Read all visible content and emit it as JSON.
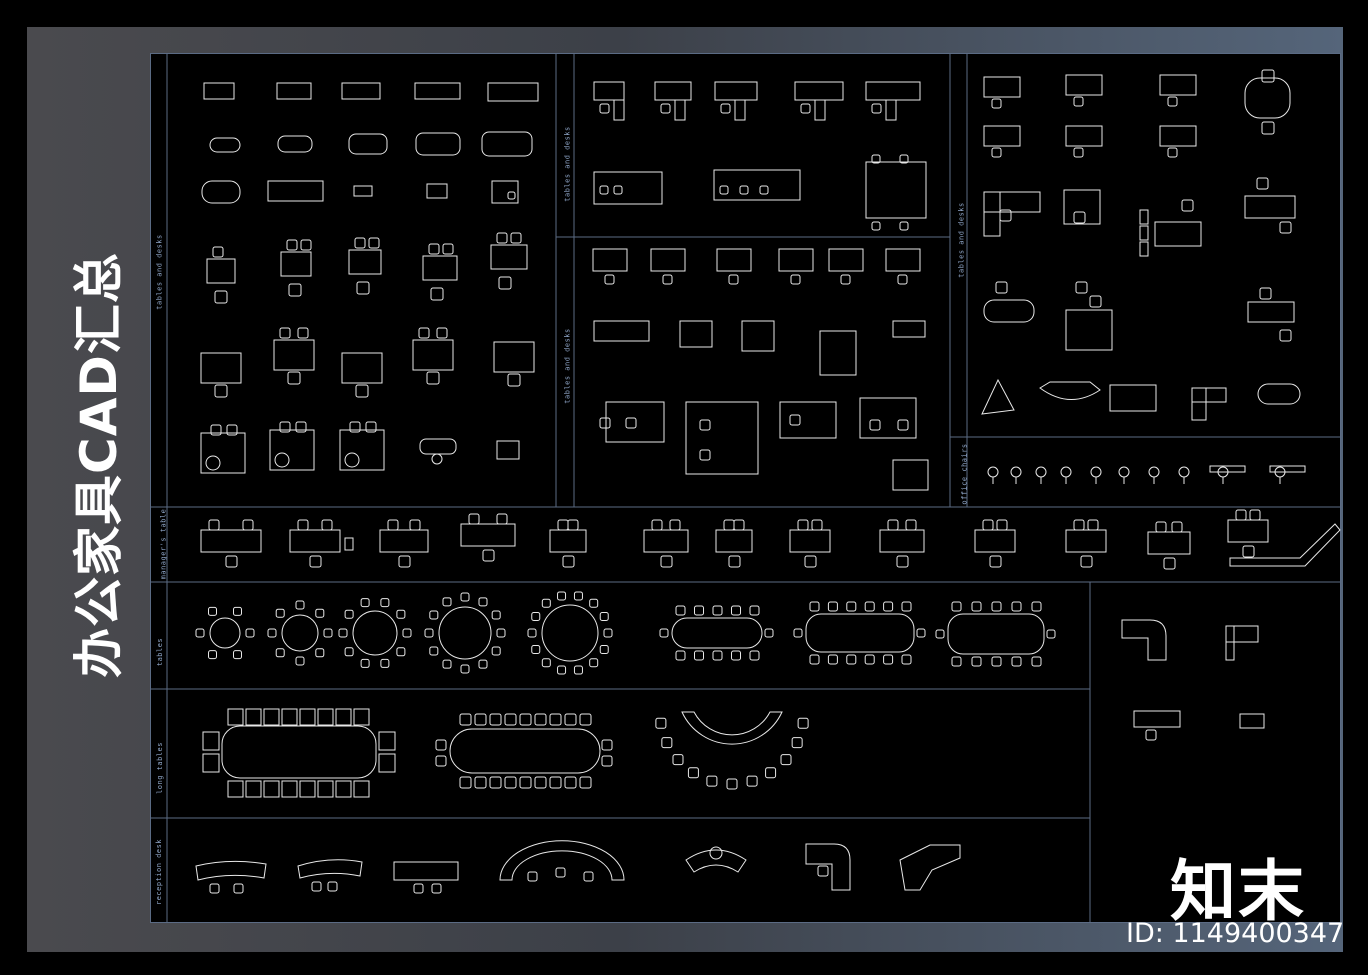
{
  "sheet_title": "办公家具CAD汇总",
  "watermark_brand": "知末",
  "image_id": "ID: 1149400347",
  "section_labels": {
    "tables_desks_1": "tables and desks",
    "tables_desks_2": "tables and desks",
    "tables_desks_3": "tables and desks",
    "tables_desks_4": "tables and desks",
    "office_chairs": "office chairs",
    "managers_table": "manager's table",
    "tables": "tables",
    "long_tables": "long tables",
    "reception_desk": "reception desk"
  },
  "colors": {
    "line": "#e8e8e8",
    "frame": "#5b6b84",
    "label": "#8fa6c8",
    "background": "#000000"
  }
}
